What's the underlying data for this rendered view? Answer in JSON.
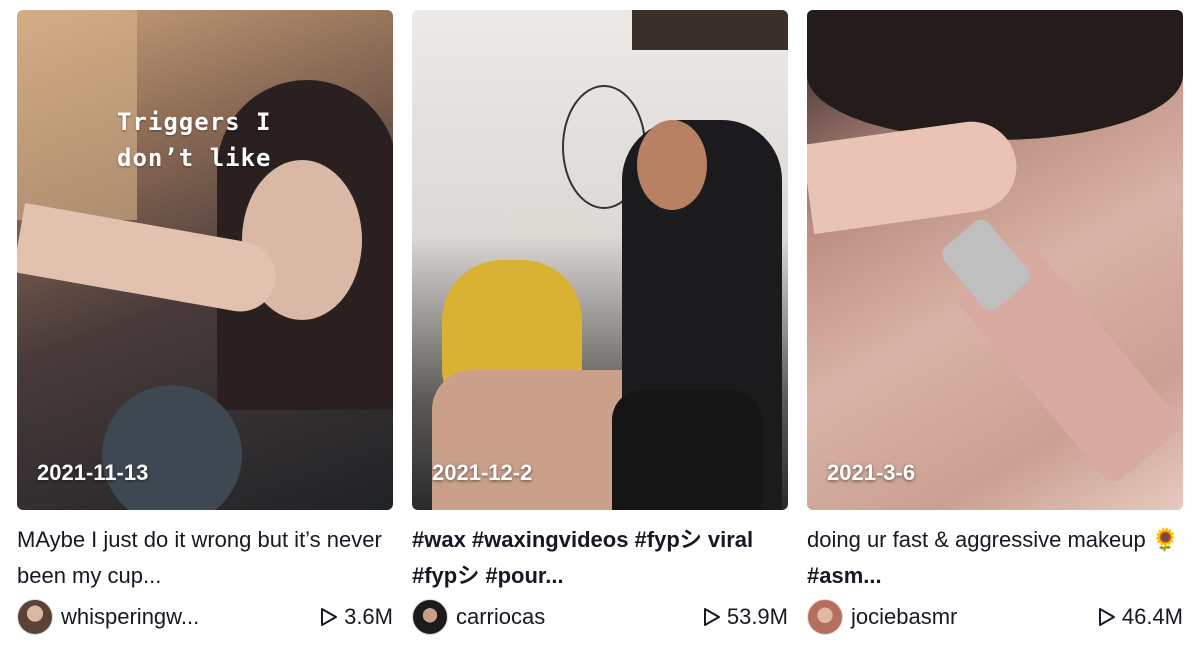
{
  "videos": [
    {
      "overlay_text": "Triggers I\ndon’t like",
      "date": "2021-11-13",
      "caption": "MAybe I just do it wrong but it’s never been my cup...",
      "caption_emoji": "",
      "username": "whisperingw...",
      "views": "3.6M"
    },
    {
      "overlay_text": "",
      "date": "2021-12-2",
      "caption": "#wax #waxingvideos #fypシ viral #fypシ #pour...",
      "caption_emoji": "",
      "username": "carriocas",
      "views": "53.9M"
    },
    {
      "overlay_text": "",
      "date": "2021-3-6",
      "caption_start": "doing ur fast & aggressive makeup ",
      "caption_emoji": "🌻",
      "caption_tag": " #asm...",
      "username": "jociebasmr",
      "views": "46.4M"
    }
  ],
  "colors": {
    "text": "#161823",
    "overlay": "#ffffff"
  },
  "icons": {
    "views": "play-icon"
  }
}
